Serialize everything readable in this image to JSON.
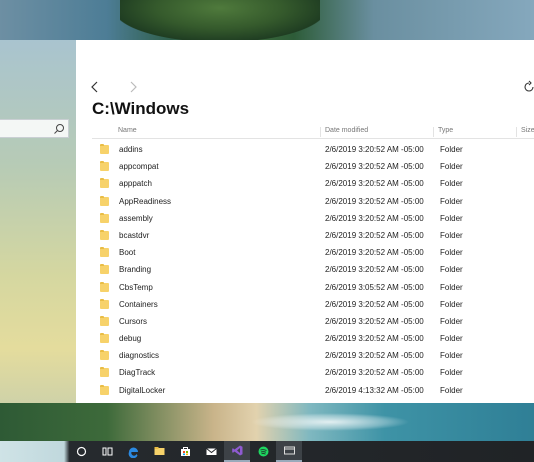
{
  "explorer": {
    "path": "C:\\Windows",
    "columns": {
      "name": "Name",
      "date": "Date modified",
      "type": "Type",
      "size": "Size"
    },
    "files": [
      {
        "name": "addins",
        "date": "2/6/2019 3:20:52 AM -05:00",
        "type": "Folder"
      },
      {
        "name": "appcompat",
        "date": "2/6/2019 3:20:52 AM -05:00",
        "type": "Folder"
      },
      {
        "name": "apppatch",
        "date": "2/6/2019 3:20:52 AM -05:00",
        "type": "Folder"
      },
      {
        "name": "AppReadiness",
        "date": "2/6/2019 3:20:52 AM -05:00",
        "type": "Folder"
      },
      {
        "name": "assembly",
        "date": "2/6/2019 3:20:52 AM -05:00",
        "type": "Folder"
      },
      {
        "name": "bcastdvr",
        "date": "2/6/2019 3:20:52 AM -05:00",
        "type": "Folder"
      },
      {
        "name": "Boot",
        "date": "2/6/2019 3:20:52 AM -05:00",
        "type": "Folder"
      },
      {
        "name": "Branding",
        "date": "2/6/2019 3:20:52 AM -05:00",
        "type": "Folder"
      },
      {
        "name": "CbsTemp",
        "date": "2/6/2019 3:05:52 AM -05:00",
        "type": "Folder"
      },
      {
        "name": "Containers",
        "date": "2/6/2019 3:20:52 AM -05:00",
        "type": "Folder"
      },
      {
        "name": "Cursors",
        "date": "2/6/2019 3:20:52 AM -05:00",
        "type": "Folder"
      },
      {
        "name": "debug",
        "date": "2/6/2019 3:20:52 AM -05:00",
        "type": "Folder"
      },
      {
        "name": "diagnostics",
        "date": "2/6/2019 3:20:52 AM -05:00",
        "type": "Folder"
      },
      {
        "name": "DiagTrack",
        "date": "2/6/2019 3:20:52 AM -05:00",
        "type": "Folder"
      },
      {
        "name": "DigitalLocker",
        "date": "2/6/2019 4:13:32 AM -05:00",
        "type": "Folder"
      }
    ]
  },
  "taskbar": {
    "items": [
      {
        "icon": "cortana-icon"
      },
      {
        "icon": "task-view-icon"
      },
      {
        "icon": "edge-icon"
      },
      {
        "icon": "file-explorer-icon"
      },
      {
        "icon": "store-icon"
      },
      {
        "icon": "mail-icon"
      },
      {
        "icon": "visual-studio-icon"
      },
      {
        "icon": "spotify-icon"
      },
      {
        "icon": "files-app-icon"
      }
    ]
  },
  "colors": {
    "folder": "#f7d26a",
    "taskbar": "#202326",
    "edge": "#2b8ae2",
    "visual_studio": "#8f5bd1",
    "spotify": "#1ed760"
  }
}
